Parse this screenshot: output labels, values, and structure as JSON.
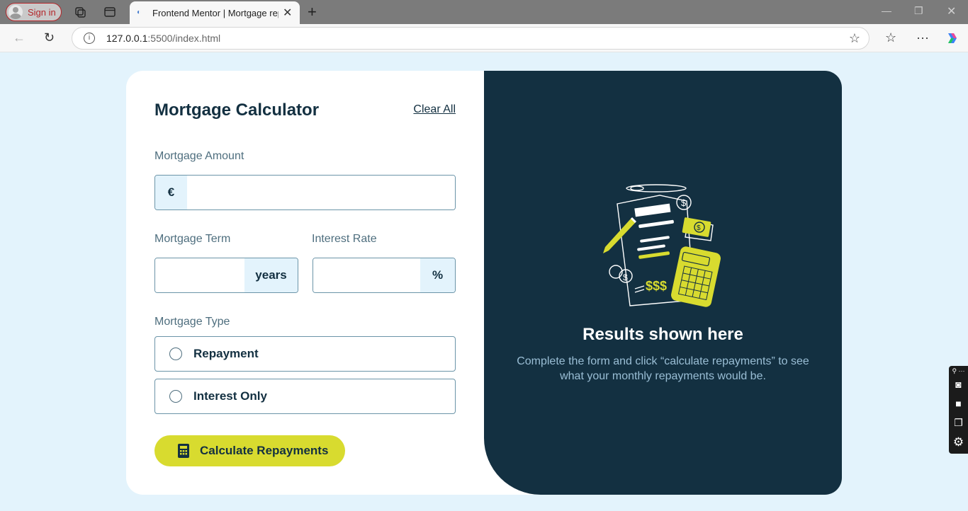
{
  "browser": {
    "signin_label": "Sign in",
    "tab_title": "Frontend Mentor | Mortgage repayment calculator",
    "new_tab_symbol": "+",
    "url_host": "127.0.0.1",
    "url_rest": ":5500/index.html"
  },
  "form": {
    "title": "Mortgage Calculator",
    "clear_all": "Clear All",
    "amount_label": "Mortgage Amount",
    "amount_prefix": "€",
    "amount_value": "",
    "term_label": "Mortgage Term",
    "term_suffix": "years",
    "term_value": "",
    "rate_label": "Interest Rate",
    "rate_suffix": "%",
    "rate_value": "",
    "type_label": "Mortgage Type",
    "types": [
      {
        "label": "Repayment",
        "selected": false
      },
      {
        "label": "Interest Only",
        "selected": false
      }
    ],
    "submit_label": "Calculate Repayments"
  },
  "results": {
    "title": "Results shown here",
    "description": "Complete the form and click “calculate repayments” to see what your monthly repayments would be."
  },
  "colors": {
    "accent_lime": "#d8db2f",
    "slate_900": "#133041",
    "slate_100": "#e3f3fc"
  }
}
